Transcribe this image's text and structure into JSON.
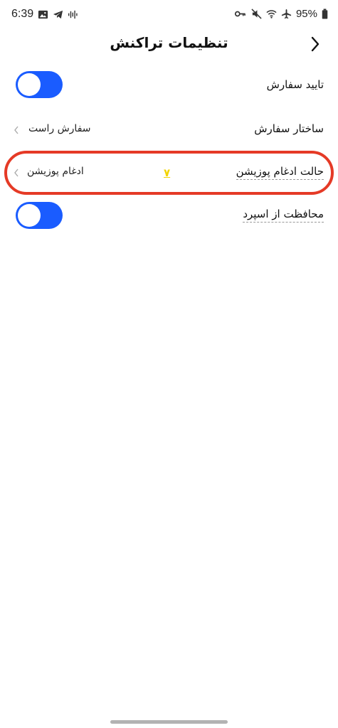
{
  "status_bar": {
    "time": "6:39",
    "battery": "95%"
  },
  "header": {
    "title": "تنظیمات تراکنش"
  },
  "settings": {
    "order_confirm": {
      "label": "تایید سفارش",
      "enabled": true
    },
    "order_structure": {
      "label": "ساختار سفارش",
      "value": "سفارش راست"
    },
    "position_merge": {
      "label": "حالت ادغام پوزیشن",
      "value": "ادغام پوزیشن"
    },
    "spread_protection": {
      "label": "محافظت از اسپرد",
      "enabled": true
    }
  },
  "annotation": {
    "mark": "۷"
  },
  "colors": {
    "toggle_on": "#1a5cff",
    "highlight": "#e53a26",
    "annotation": "#f2d400"
  }
}
